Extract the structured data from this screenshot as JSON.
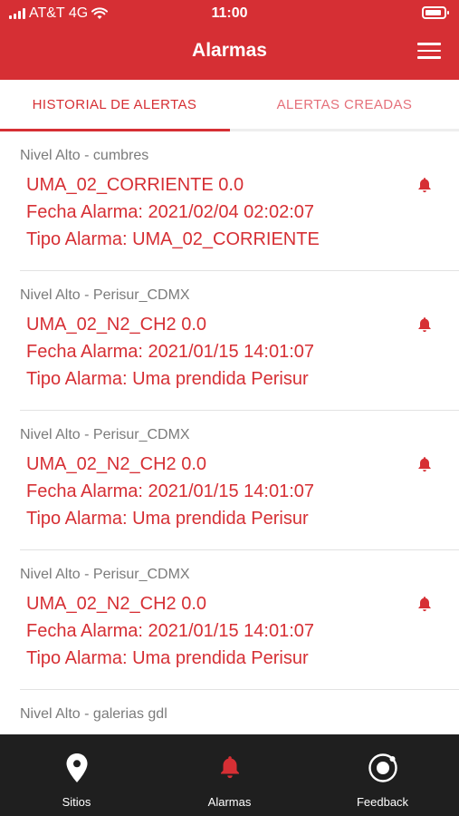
{
  "status_bar": {
    "carrier": "AT&T 4G",
    "time": "11:00"
  },
  "header": {
    "title": "Alarmas",
    "menu_icon": "hamburger-menu-icon"
  },
  "tabs": [
    {
      "label": "HISTORIAL DE ALERTAS",
      "active": true
    },
    {
      "label": "ALERTAS CREADAS",
      "active": false
    }
  ],
  "alerts": [
    {
      "site": "Nivel Alto - cumbres",
      "name": "UMA_02_CORRIENTE 0.0",
      "date": "Fecha Alarma: 2021/02/04 02:02:07",
      "type": "Tipo Alarma: UMA_02_CORRIENTE",
      "icon": "bell-icon"
    },
    {
      "site": "Nivel Alto - Perisur_CDMX",
      "name": "UMA_02_N2_CH2 0.0",
      "date": "Fecha Alarma: 2021/01/15 14:01:07",
      "type": "Tipo Alarma: Uma prendida Perisur",
      "icon": "bell-icon"
    },
    {
      "site": "Nivel Alto - Perisur_CDMX",
      "name": "UMA_02_N2_CH2 0.0",
      "date": "Fecha Alarma: 2021/01/15 14:01:07",
      "type": "Tipo Alarma: Uma prendida Perisur",
      "icon": "bell-icon"
    },
    {
      "site": "Nivel Alto - Perisur_CDMX",
      "name": "UMA_02_N2_CH2 0.0",
      "date": "Fecha Alarma: 2021/01/15 14:01:07",
      "type": "Tipo Alarma: Uma prendida Perisur",
      "icon": "bell-icon"
    },
    {
      "site": "Nivel Alto - galerias gdl"
    }
  ],
  "tabbar": [
    {
      "label": "Sitios",
      "icon": "map-pin-icon"
    },
    {
      "label": "Alarmas",
      "icon": "bell-icon",
      "active": true
    },
    {
      "label": "Feedback",
      "icon": "feedback-icon"
    }
  ],
  "colors": {
    "brand": "#d62f34",
    "tab_inactive": "#e5707a",
    "tabbar_bg": "#1f1f1f"
  }
}
